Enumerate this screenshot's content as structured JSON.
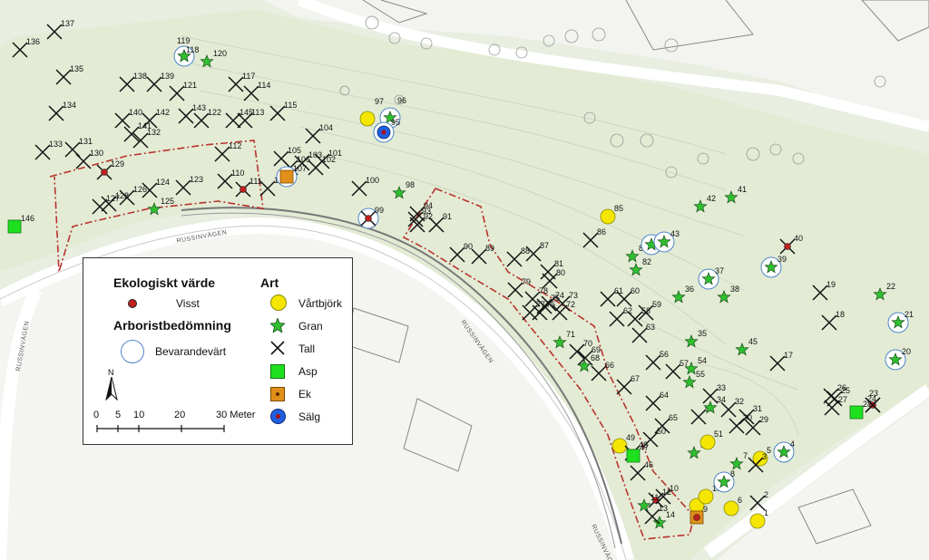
{
  "legend": {
    "eco_title": "Ekologiskt värde",
    "eco_item": "Visst",
    "arbor_title": "Arboristbedömning",
    "arbor_item": "Bevarandevärt",
    "species_title": "Art",
    "species": [
      {
        "label": "Vårtbjörk",
        "symbol": "yellow-circle",
        "color": "#f4e600"
      },
      {
        "label": "Gran",
        "symbol": "green-star",
        "color": "#2fbf2f"
      },
      {
        "label": "Tall",
        "symbol": "black-x",
        "color": "#111111"
      },
      {
        "label": "Asp",
        "symbol": "green-square",
        "color": "#1fe01f"
      },
      {
        "label": "Ek",
        "symbol": "orange-square",
        "color": "#e0901a"
      },
      {
        "label": "Sälg",
        "symbol": "blue-circle",
        "color": "#1f5fe0"
      }
    ],
    "north": "N",
    "scale_ticks": [
      "0",
      "5",
      "10",
      "20",
      "30 Meter"
    ]
  },
  "roads": [
    "RUSSINVÄGEN",
    "RUSSINVÄGEN",
    "RUSSINVÄGEN",
    "RUSSINVÄGEN"
  ],
  "trees": [
    {
      "id": "137",
      "type": "tall"
    },
    {
      "id": "136",
      "type": "tall"
    },
    {
      "id": "135",
      "type": "tall"
    },
    {
      "id": "138",
      "type": "tall"
    },
    {
      "id": "139",
      "type": "tall"
    },
    {
      "id": "119",
      "type": "gran",
      "bevar": true
    },
    {
      "id": "118",
      "type": "gran"
    },
    {
      "id": "120",
      "type": "gran"
    },
    {
      "id": "121",
      "type": "tall"
    },
    {
      "id": "117",
      "type": "tall"
    },
    {
      "id": "114",
      "type": "tall"
    },
    {
      "id": "134",
      "type": "tall"
    },
    {
      "id": "140",
      "type": "tall"
    },
    {
      "id": "142",
      "type": "tall"
    },
    {
      "id": "143",
      "type": "tall"
    },
    {
      "id": "141",
      "type": "tall"
    },
    {
      "id": "122",
      "type": "tall"
    },
    {
      "id": "145",
      "type": "tall"
    },
    {
      "id": "113",
      "type": "tall"
    },
    {
      "id": "115",
      "type": "tall"
    },
    {
      "id": "133",
      "type": "tall"
    },
    {
      "id": "131",
      "type": "tall"
    },
    {
      "id": "130",
      "type": "tall"
    },
    {
      "id": "132",
      "type": "tall"
    },
    {
      "id": "129",
      "type": "tall",
      "visst": true
    },
    {
      "id": "127",
      "type": "tall"
    },
    {
      "id": "128",
      "type": "tall"
    },
    {
      "id": "126",
      "type": "tall"
    },
    {
      "id": "124",
      "type": "tall"
    },
    {
      "id": "125",
      "type": "gran"
    },
    {
      "id": "123",
      "type": "tall"
    },
    {
      "id": "112",
      "type": "tall"
    },
    {
      "id": "110",
      "type": "tall"
    },
    {
      "id": "111",
      "type": "tall",
      "visst": true
    },
    {
      "id": "109",
      "type": "tall"
    },
    {
      "id": "146",
      "type": "asp"
    },
    {
      "id": "105",
      "type": "tall"
    },
    {
      "id": "106",
      "type": "tall"
    },
    {
      "id": "107",
      "type": "ek",
      "bevar": true
    },
    {
      "id": "103",
      "type": "tall"
    },
    {
      "id": "102",
      "type": "tall"
    },
    {
      "id": "101",
      "type": "tall"
    },
    {
      "id": "104",
      "type": "tall"
    },
    {
      "id": "100",
      "type": "tall"
    },
    {
      "id": "97",
      "type": "vartbjork"
    },
    {
      "id": "96",
      "type": "gran",
      "bevar": true
    },
    {
      "id": "95",
      "type": "salg",
      "bevar": true
    },
    {
      "id": "98",
      "type": "gran"
    },
    {
      "id": "99",
      "type": "tall",
      "visst": true,
      "bevar": true
    },
    {
      "id": "94",
      "type": "tall"
    },
    {
      "id": "93",
      "type": "tall"
    },
    {
      "id": "92",
      "type": "tall"
    },
    {
      "id": "91",
      "type": "tall"
    },
    {
      "id": "90",
      "type": "tall"
    },
    {
      "id": "89",
      "type": "tall"
    },
    {
      "id": "88",
      "type": "tall"
    },
    {
      "id": "87",
      "type": "tall"
    },
    {
      "id": "86",
      "type": "tall"
    },
    {
      "id": "85",
      "type": "vartbjork"
    },
    {
      "id": "84",
      "type": "gran"
    },
    {
      "id": "83",
      "type": "gran"
    },
    {
      "id": "82",
      "type": "gran"
    },
    {
      "id": "81",
      "type": "tall"
    },
    {
      "id": "80",
      "type": "tall"
    },
    {
      "id": "79",
      "type": "tall"
    },
    {
      "id": "78",
      "type": "tall"
    },
    {
      "id": "77",
      "type": "tall"
    },
    {
      "id": "76",
      "type": "tall"
    },
    {
      "id": "75",
      "type": "tall"
    },
    {
      "id": "74",
      "type": "tall"
    },
    {
      "id": "73",
      "type": "tall"
    },
    {
      "id": "72",
      "type": "tall"
    },
    {
      "id": "71",
      "type": "gran"
    },
    {
      "id": "70",
      "type": "tall"
    },
    {
      "id": "69",
      "type": "tall"
    },
    {
      "id": "68",
      "type": "gran"
    },
    {
      "id": "66",
      "type": "tall"
    },
    {
      "id": "67",
      "type": "tall"
    },
    {
      "id": "61",
      "type": "tall"
    },
    {
      "id": "60",
      "type": "tall"
    },
    {
      "id": "62",
      "type": "tall"
    },
    {
      "id": "58",
      "type": "tall"
    },
    {
      "id": "59",
      "type": "tall"
    },
    {
      "id": "63",
      "type": "tall"
    },
    {
      "id": "64",
      "type": "tall"
    },
    {
      "id": "65",
      "type": "tall"
    },
    {
      "id": "56",
      "type": "tall"
    },
    {
      "id": "57",
      "type": "tall"
    },
    {
      "id": "55",
      "type": "gran"
    },
    {
      "id": "54",
      "type": "gran"
    },
    {
      "id": "53",
      "type": "tall"
    },
    {
      "id": "52",
      "type": "gran"
    },
    {
      "id": "51",
      "type": "vartbjork"
    },
    {
      "id": "50",
      "type": "tall"
    },
    {
      "id": "49",
      "type": "vartbjork"
    },
    {
      "id": "48",
      "type": "tall"
    },
    {
      "id": "47",
      "type": "asp"
    },
    {
      "id": "46",
      "type": "tall"
    },
    {
      "id": "45",
      "type": "gran"
    },
    {
      "id": "44",
      "type": "gran",
      "bevar": true
    },
    {
      "id": "43",
      "type": "gran",
      "bevar": true
    },
    {
      "id": "42",
      "type": "gran"
    },
    {
      "id": "41",
      "type": "gran"
    },
    {
      "id": "40",
      "type": "tall",
      "visst": true
    },
    {
      "id": "39",
      "type": "gran",
      "bevar": true
    },
    {
      "id": "38",
      "type": "gran"
    },
    {
      "id": "37",
      "type": "gran",
      "bevar": true
    },
    {
      "id": "36",
      "type": "gran"
    },
    {
      "id": "35",
      "type": "gran"
    },
    {
      "id": "34",
      "type": "gran"
    },
    {
      "id": "33",
      "type": "tall"
    },
    {
      "id": "32",
      "type": "tall"
    },
    {
      "id": "31",
      "type": "tall"
    },
    {
      "id": "30",
      "type": "tall"
    },
    {
      "id": "29",
      "type": "tall"
    },
    {
      "id": "28",
      "type": "asp"
    },
    {
      "id": "27",
      "type": "tall"
    },
    {
      "id": "26",
      "type": "tall"
    },
    {
      "id": "25",
      "type": "tall"
    },
    {
      "id": "24",
      "type": "tall",
      "visst": true
    },
    {
      "id": "23",
      "type": "tall"
    },
    {
      "id": "22",
      "type": "gran"
    },
    {
      "id": "21",
      "type": "gran",
      "bevar": true
    },
    {
      "id": "20",
      "type": "gran",
      "bevar": true
    },
    {
      "id": "19",
      "type": "tall"
    },
    {
      "id": "18",
      "type": "tall"
    },
    {
      "id": "17",
      "type": "tall"
    },
    {
      "id": "16",
      "type": "vartbjork"
    },
    {
      "id": "15",
      "type": "vartbjork"
    },
    {
      "id": "14",
      "type": "gran"
    },
    {
      "id": "13",
      "type": "tall"
    },
    {
      "id": "12",
      "type": "tall",
      "visst": true
    },
    {
      "id": "11",
      "type": "gran"
    },
    {
      "id": "10",
      "type": "tall"
    },
    {
      "id": "9",
      "type": "ek",
      "visst": true
    },
    {
      "id": "8",
      "type": "gran",
      "bevar": true
    },
    {
      "id": "7",
      "type": "gran"
    },
    {
      "id": "6",
      "type": "vartbjork"
    },
    {
      "id": "5",
      "type": "vartbjork"
    },
    {
      "id": "4",
      "type": "gran",
      "bevar": true
    },
    {
      "id": "3",
      "type": "tall"
    },
    {
      "id": "2",
      "type": "tall"
    },
    {
      "id": "1",
      "type": "vartbjork"
    }
  ]
}
